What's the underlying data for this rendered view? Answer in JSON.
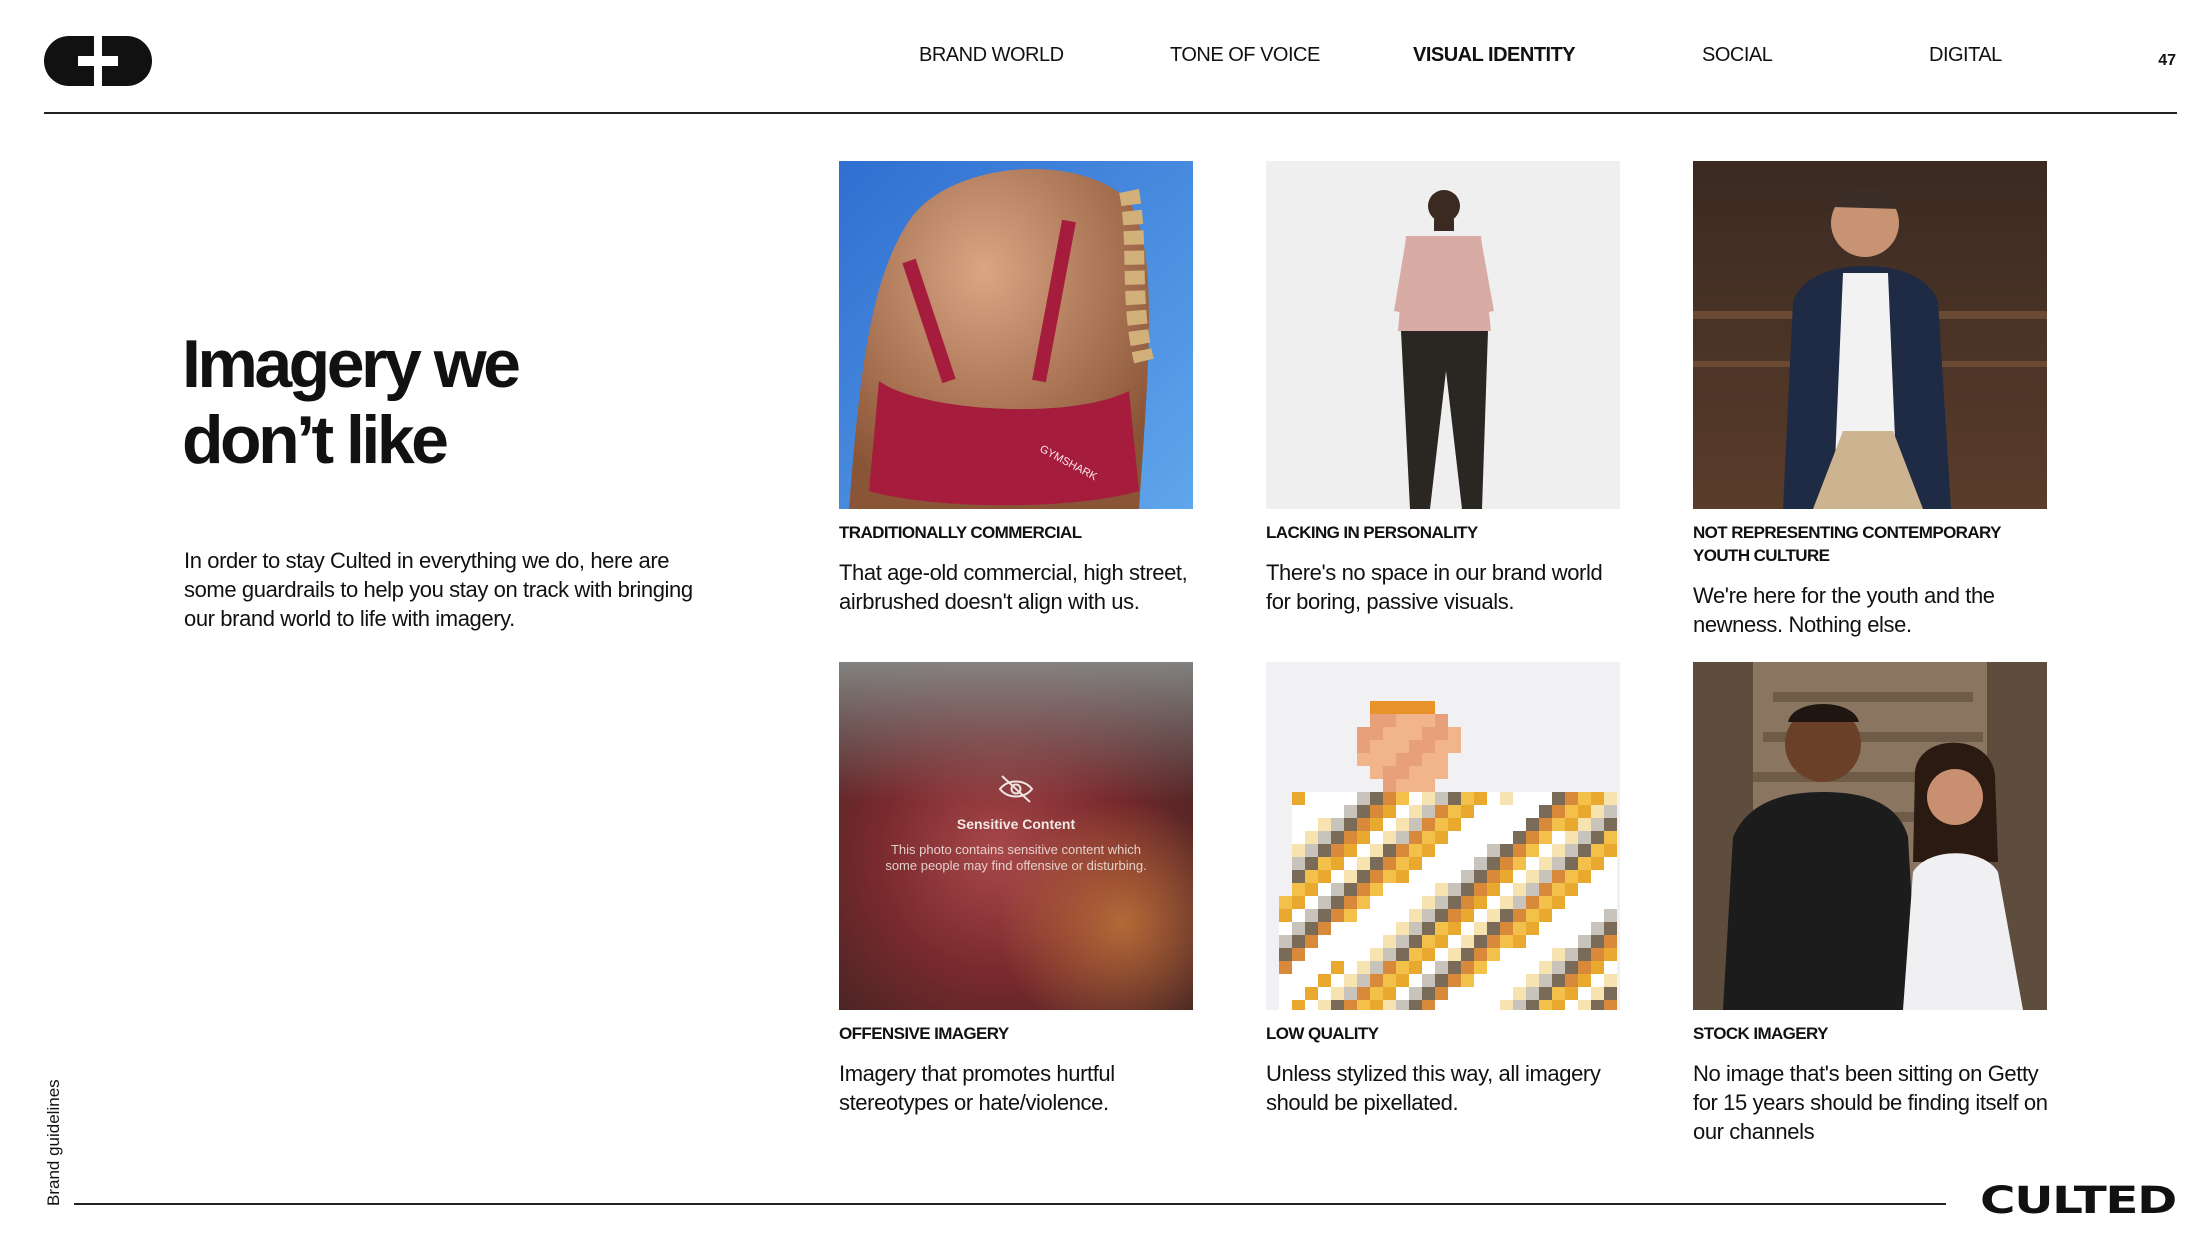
{
  "header": {
    "nav": [
      {
        "label": "BRAND WORLD",
        "active": false
      },
      {
        "label": "TONE OF VOICE",
        "active": false
      },
      {
        "label": "VISUAL IDENTITY",
        "active": true
      },
      {
        "label": "SOCIAL",
        "active": false
      },
      {
        "label": "DIGITAL",
        "active": false
      }
    ],
    "page_number": "47"
  },
  "main": {
    "headline_line1": "Imagery we",
    "headline_line2": "don’t like",
    "intro": "In order to stay Culted in everything we do, here are some guardrails to help you stay on track with bringing our brand world to life with imagery."
  },
  "tiles": [
    {
      "title": "TRADITIONALLY COMMERCIAL",
      "desc": "That age-old commercial, high street, airbrushed doesn't align with us.",
      "photo_text": "GYMSHARK"
    },
    {
      "title": "LACKING IN PERSONALITY",
      "desc": "There's no space in our brand world for boring, passive visuals."
    },
    {
      "title": "NOT REPRESENTING CONTEMPORARY YOUTH CULTURE",
      "desc": "We're here for the youth and the newness. Nothing else."
    },
    {
      "title": "OFFENSIVE IMAGERY",
      "desc": "Imagery that promotes hurtful stereotypes or hate/violence.",
      "overlay_title": "Sensitive Content",
      "overlay_text_1": "This photo contains sensitive content which",
      "overlay_text_2": "some people may find offensive or disturbing."
    },
    {
      "title": "LOW QUALITY",
      "desc": "Unless stylized this way, all imagery should be pixellated."
    },
    {
      "title": "STOCK IMAGERY",
      "desc": "No image that's been sitting on Getty for 15 years should be finding itself on our channels"
    }
  ],
  "footer": {
    "side_label": "Brand guidelines",
    "wordmark": "CULTED"
  },
  "colors": {
    "text": "#111111",
    "background": "#ffffff"
  }
}
